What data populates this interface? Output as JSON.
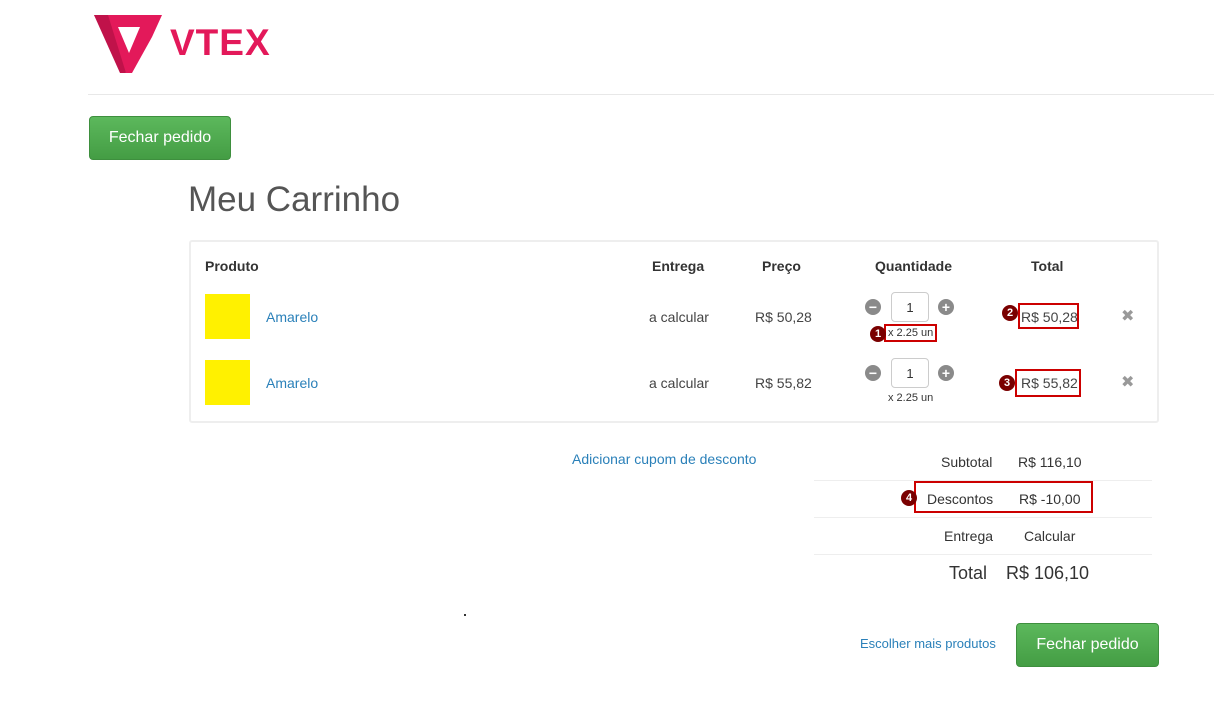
{
  "header": {
    "logo_text": "VTEX",
    "brand_color": "#e3195a"
  },
  "actions": {
    "checkout_label": "Fechar pedido",
    "more_products_label": "Escolher mais produtos"
  },
  "page": {
    "title": "Meu Carrinho"
  },
  "table": {
    "headers": {
      "product": "Produto",
      "delivery": "Entrega",
      "price": "Preço",
      "quantity": "Quantidade",
      "total": "Total"
    },
    "rows": [
      {
        "product": "Amarelo",
        "swatch_color": "#fff100",
        "delivery": "a calcular",
        "price": "R$ 50,28",
        "quantity": "1",
        "unit_note": "x 2.25 un",
        "total": "R$ 50,28"
      },
      {
        "product": "Amarelo",
        "swatch_color": "#fff100",
        "delivery": "a calcular",
        "price": "R$ 55,82",
        "quantity": "1",
        "unit_note": "x 2.25 un",
        "total": "R$ 55,82"
      }
    ]
  },
  "coupon": {
    "label": "Adicionar cupom de desconto"
  },
  "summary": {
    "subtotal_label": "Subtotal",
    "subtotal_value": "R$ 116,10",
    "discounts_label": "Descontos",
    "discounts_value": "R$ -10,00",
    "delivery_label": "Entrega",
    "delivery_value": "Calcular",
    "total_label": "Total",
    "total_value": "R$ 106,10"
  },
  "annotations": {
    "m1": "1",
    "m2": "2",
    "m3": "3",
    "m4": "4"
  },
  "icons": {
    "minus": "minus-circle-icon",
    "plus": "plus-circle-icon",
    "remove": "close-icon"
  },
  "colors": {
    "accent_green": "#5cb85c",
    "link_blue": "#2a80b9",
    "highlight_red": "#cc0000"
  }
}
